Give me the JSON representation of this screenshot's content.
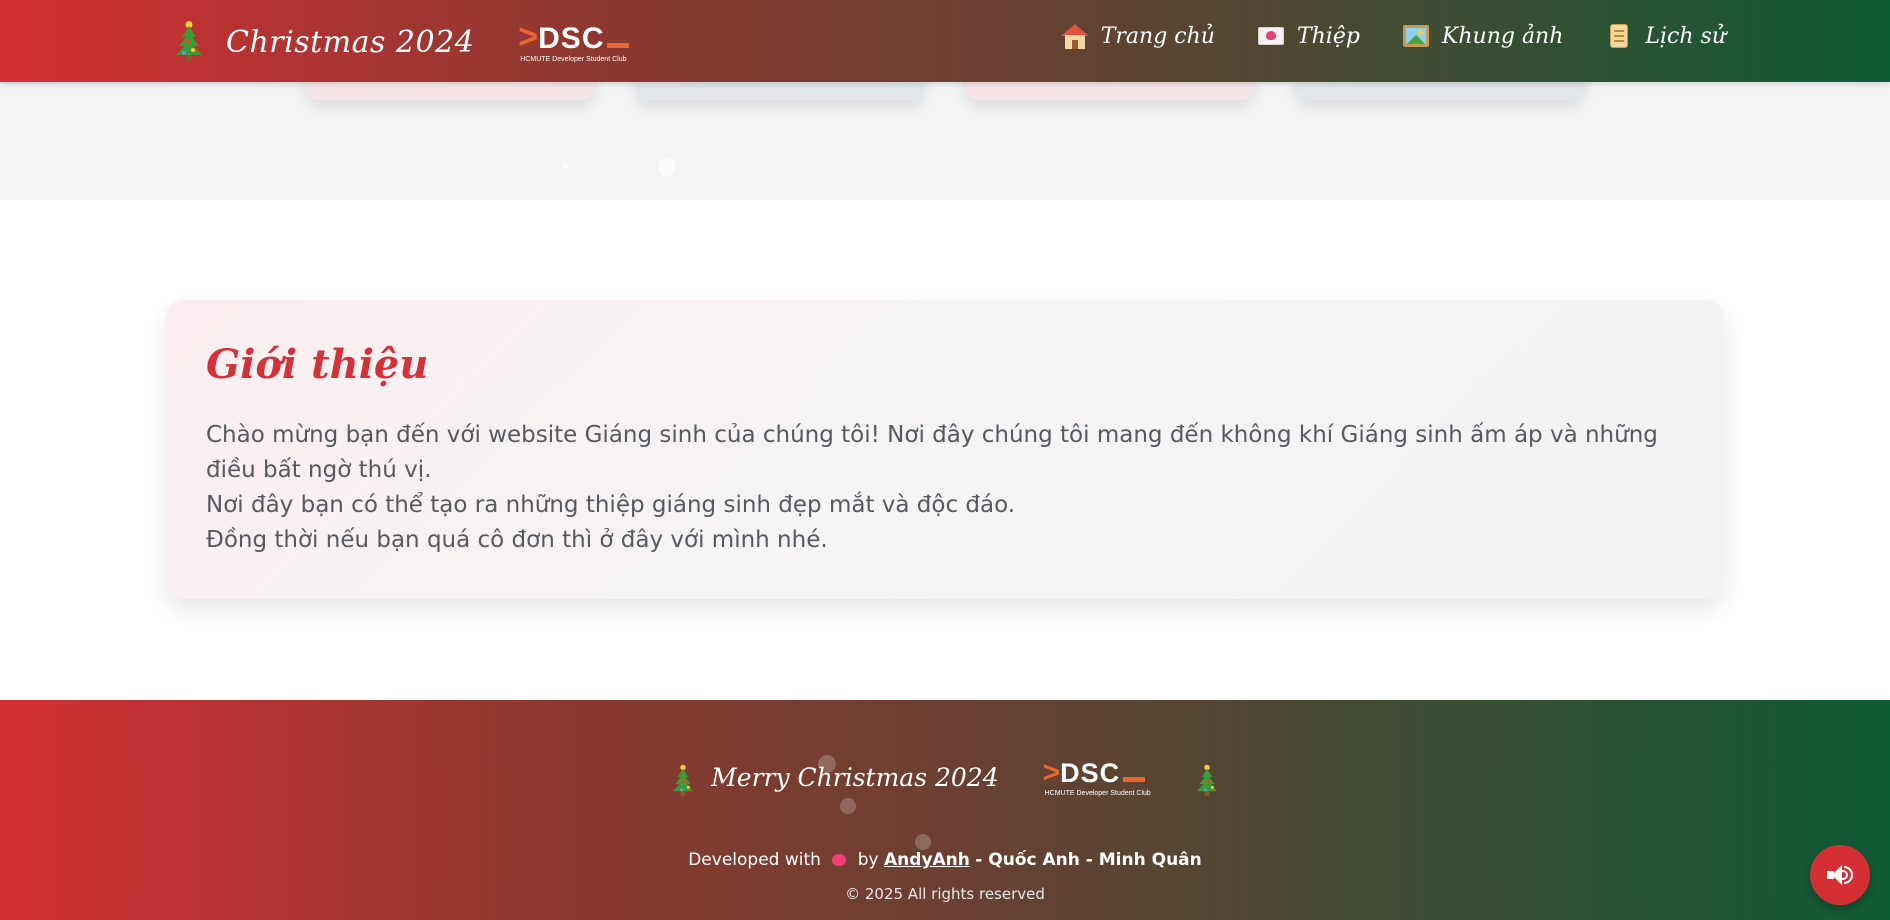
{
  "header": {
    "brand_title": "Christmas 2024",
    "logo": {
      "word": "DSC",
      "subtitle": "HCMUTE Developer Student Club"
    },
    "nav": [
      {
        "label": "Trang chủ",
        "icon": "house-icon"
      },
      {
        "label": "Thiệp",
        "icon": "love-letter-icon"
      },
      {
        "label": "Khung ảnh",
        "icon": "framed-picture-icon"
      },
      {
        "label": "Lịch sử",
        "icon": "scroll-icon"
      }
    ]
  },
  "intro": {
    "title": "Giới thiệu",
    "paragraph_1": "Chào mừng bạn đến với website Giáng sinh của chúng tôi! Nơi đây chúng tôi mang đến không khí Giáng sinh ấm áp và những điều bất ngờ thú vị.",
    "paragraph_2": "Nơi đây bạn có thể tạo ra những thiệp giáng sinh đẹp mắt và độc đáo.",
    "paragraph_3": "Đồng thời nếu bạn quá cô đơn thì ở đây với mình nhé."
  },
  "footer": {
    "title": "Merry Christmas 2024",
    "logo": {
      "word": "DSC",
      "subtitle": "HCMUTE Developer Student Club"
    },
    "credit_prefix": "Developed with",
    "credit_by": "by",
    "credit_link": "AndyAnh",
    "credit_names": "- Quốc Anh - Minh Quân",
    "copyright": "© 2025 All rights reserved"
  },
  "sound_button": {
    "icon": "speaker-icon",
    "state": "on"
  },
  "colors": {
    "brand_red": "#d42f34",
    "brand_green": "#0f5b35",
    "accent_orange": "#e8662f",
    "title_red": "#d2323a"
  }
}
